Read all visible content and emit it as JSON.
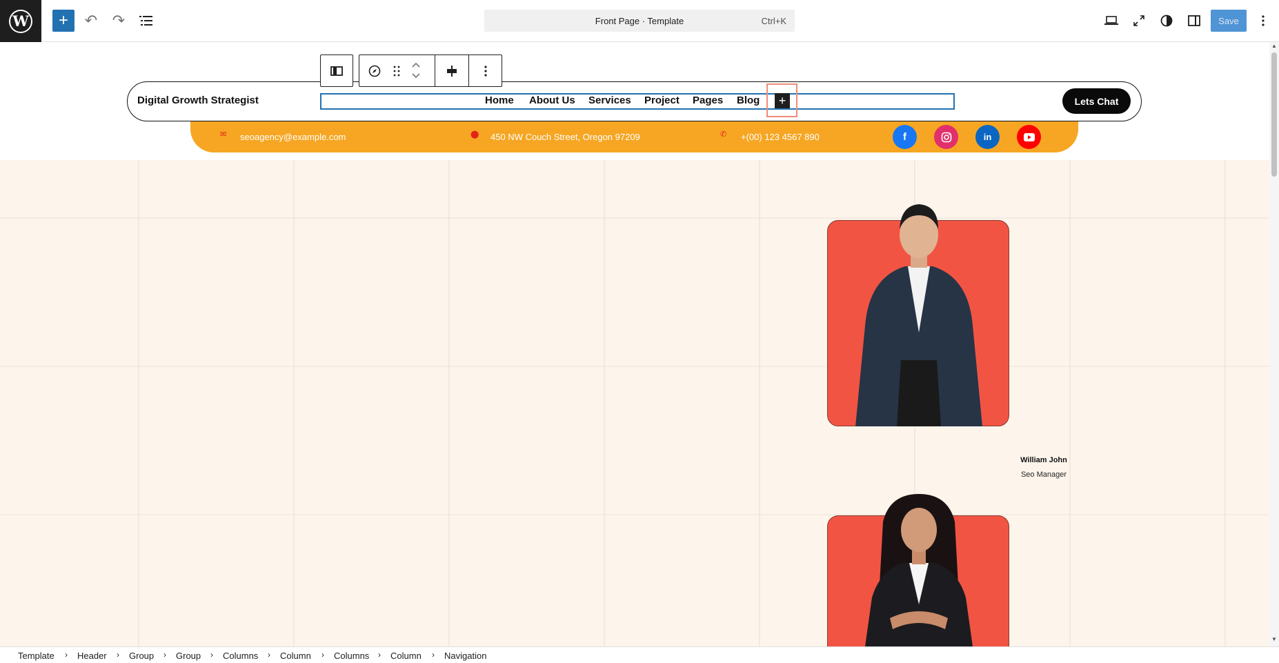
{
  "topbar": {
    "add_label": "+",
    "undo_label": "↶",
    "redo_label": "↷",
    "command_title": "Front Page · Template",
    "command_shortcut": "Ctrl+K",
    "save_label": "Save"
  },
  "header": {
    "site_title": "Digital Growth Strategist",
    "nav": [
      "Home",
      "About Us",
      "Services",
      "Project",
      "Pages",
      "Blog"
    ],
    "nav_add_label": "+",
    "cta_label": "Lets Chat"
  },
  "info_bar": {
    "email": "seoagency@example.com",
    "address": "450 NW Couch Street, Oregon 97209",
    "phone": "+(00) 123 4567 890",
    "socials": [
      "facebook",
      "instagram",
      "linkedin",
      "youtube"
    ]
  },
  "team": [
    {
      "name": "William John",
      "role": "Seo Manager"
    }
  ],
  "breadcrumb": [
    "Template",
    "Header",
    "Group",
    "Group",
    "Columns",
    "Column",
    "Columns",
    "Column",
    "Navigation"
  ],
  "colors": {
    "accent": "#2271b1",
    "info_bar": "#f6a623",
    "card": "#f25443",
    "facebook": "#1877f2",
    "instagram": "#e1306c",
    "linkedin": "#0a66c2",
    "youtube": "#ff0000"
  }
}
